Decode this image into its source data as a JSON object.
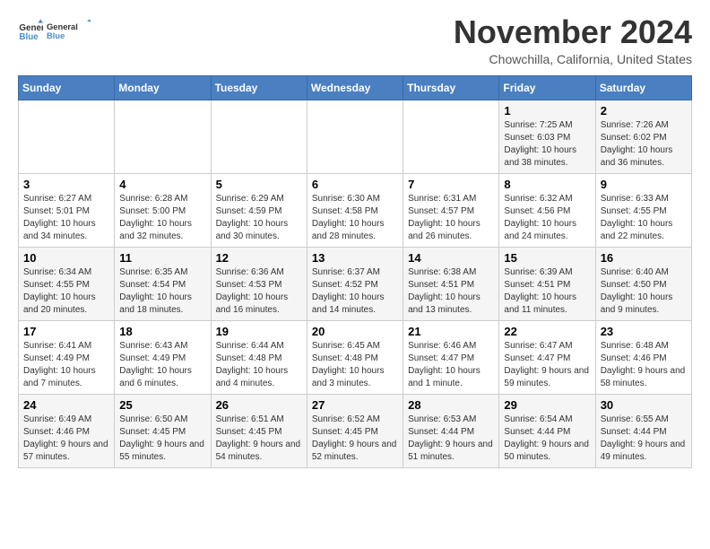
{
  "logo": {
    "line1": "General",
    "line2": "Blue"
  },
  "title": "November 2024",
  "location": "Chowchilla, California, United States",
  "weekdays": [
    "Sunday",
    "Monday",
    "Tuesday",
    "Wednesday",
    "Thursday",
    "Friday",
    "Saturday"
  ],
  "weeks": [
    [
      {
        "day": "",
        "info": ""
      },
      {
        "day": "",
        "info": ""
      },
      {
        "day": "",
        "info": ""
      },
      {
        "day": "",
        "info": ""
      },
      {
        "day": "",
        "info": ""
      },
      {
        "day": "1",
        "info": "Sunrise: 7:25 AM\nSunset: 6:03 PM\nDaylight: 10 hours and 38 minutes."
      },
      {
        "day": "2",
        "info": "Sunrise: 7:26 AM\nSunset: 6:02 PM\nDaylight: 10 hours and 36 minutes."
      }
    ],
    [
      {
        "day": "3",
        "info": "Sunrise: 6:27 AM\nSunset: 5:01 PM\nDaylight: 10 hours and 34 minutes."
      },
      {
        "day": "4",
        "info": "Sunrise: 6:28 AM\nSunset: 5:00 PM\nDaylight: 10 hours and 32 minutes."
      },
      {
        "day": "5",
        "info": "Sunrise: 6:29 AM\nSunset: 4:59 PM\nDaylight: 10 hours and 30 minutes."
      },
      {
        "day": "6",
        "info": "Sunrise: 6:30 AM\nSunset: 4:58 PM\nDaylight: 10 hours and 28 minutes."
      },
      {
        "day": "7",
        "info": "Sunrise: 6:31 AM\nSunset: 4:57 PM\nDaylight: 10 hours and 26 minutes."
      },
      {
        "day": "8",
        "info": "Sunrise: 6:32 AM\nSunset: 4:56 PM\nDaylight: 10 hours and 24 minutes."
      },
      {
        "day": "9",
        "info": "Sunrise: 6:33 AM\nSunset: 4:55 PM\nDaylight: 10 hours and 22 minutes."
      }
    ],
    [
      {
        "day": "10",
        "info": "Sunrise: 6:34 AM\nSunset: 4:55 PM\nDaylight: 10 hours and 20 minutes."
      },
      {
        "day": "11",
        "info": "Sunrise: 6:35 AM\nSunset: 4:54 PM\nDaylight: 10 hours and 18 minutes."
      },
      {
        "day": "12",
        "info": "Sunrise: 6:36 AM\nSunset: 4:53 PM\nDaylight: 10 hours and 16 minutes."
      },
      {
        "day": "13",
        "info": "Sunrise: 6:37 AM\nSunset: 4:52 PM\nDaylight: 10 hours and 14 minutes."
      },
      {
        "day": "14",
        "info": "Sunrise: 6:38 AM\nSunset: 4:51 PM\nDaylight: 10 hours and 13 minutes."
      },
      {
        "day": "15",
        "info": "Sunrise: 6:39 AM\nSunset: 4:51 PM\nDaylight: 10 hours and 11 minutes."
      },
      {
        "day": "16",
        "info": "Sunrise: 6:40 AM\nSunset: 4:50 PM\nDaylight: 10 hours and 9 minutes."
      }
    ],
    [
      {
        "day": "17",
        "info": "Sunrise: 6:41 AM\nSunset: 4:49 PM\nDaylight: 10 hours and 7 minutes."
      },
      {
        "day": "18",
        "info": "Sunrise: 6:43 AM\nSunset: 4:49 PM\nDaylight: 10 hours and 6 minutes."
      },
      {
        "day": "19",
        "info": "Sunrise: 6:44 AM\nSunset: 4:48 PM\nDaylight: 10 hours and 4 minutes."
      },
      {
        "day": "20",
        "info": "Sunrise: 6:45 AM\nSunset: 4:48 PM\nDaylight: 10 hours and 3 minutes."
      },
      {
        "day": "21",
        "info": "Sunrise: 6:46 AM\nSunset: 4:47 PM\nDaylight: 10 hours and 1 minute."
      },
      {
        "day": "22",
        "info": "Sunrise: 6:47 AM\nSunset: 4:47 PM\nDaylight: 9 hours and 59 minutes."
      },
      {
        "day": "23",
        "info": "Sunrise: 6:48 AM\nSunset: 4:46 PM\nDaylight: 9 hours and 58 minutes."
      }
    ],
    [
      {
        "day": "24",
        "info": "Sunrise: 6:49 AM\nSunset: 4:46 PM\nDaylight: 9 hours and 57 minutes."
      },
      {
        "day": "25",
        "info": "Sunrise: 6:50 AM\nSunset: 4:45 PM\nDaylight: 9 hours and 55 minutes."
      },
      {
        "day": "26",
        "info": "Sunrise: 6:51 AM\nSunset: 4:45 PM\nDaylight: 9 hours and 54 minutes."
      },
      {
        "day": "27",
        "info": "Sunrise: 6:52 AM\nSunset: 4:45 PM\nDaylight: 9 hours and 52 minutes."
      },
      {
        "day": "28",
        "info": "Sunrise: 6:53 AM\nSunset: 4:44 PM\nDaylight: 9 hours and 51 minutes."
      },
      {
        "day": "29",
        "info": "Sunrise: 6:54 AM\nSunset: 4:44 PM\nDaylight: 9 hours and 50 minutes."
      },
      {
        "day": "30",
        "info": "Sunrise: 6:55 AM\nSunset: 4:44 PM\nDaylight: 9 hours and 49 minutes."
      }
    ]
  ]
}
